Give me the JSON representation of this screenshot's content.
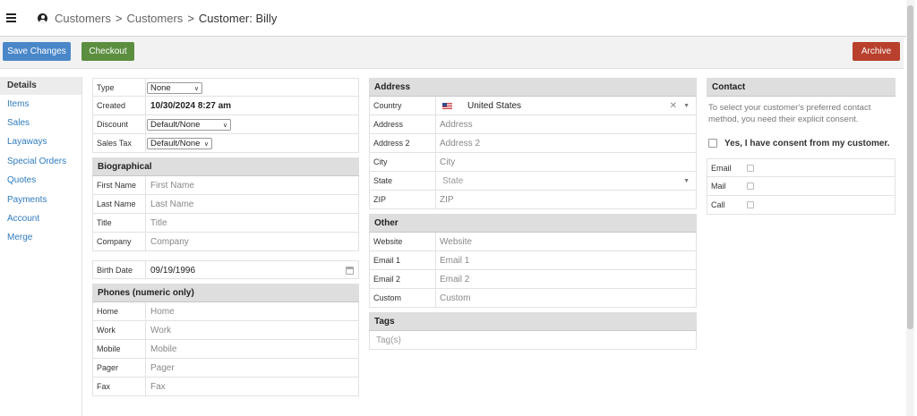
{
  "breadcrumb": {
    "items": [
      "Customers",
      "Customers"
    ],
    "separator": ">",
    "current": "Customer: Billy"
  },
  "toolbar": {
    "save_label": "Save Changes",
    "checkout_label": "Checkout",
    "archive_label": "Archive"
  },
  "colors": {
    "save": "#4a87c9",
    "checkout": "#5b8e3f",
    "archive": "#b8402c",
    "link": "#2e7bbf"
  },
  "sidebar": {
    "items": [
      {
        "label": "Details",
        "active": true
      },
      {
        "label": "Items"
      },
      {
        "label": "Sales"
      },
      {
        "label": "Layaways"
      },
      {
        "label": "Special Orders"
      },
      {
        "label": "Quotes"
      },
      {
        "label": "Payments"
      },
      {
        "label": "Account"
      },
      {
        "label": "Merge"
      }
    ]
  },
  "details": {
    "type_label": "Type",
    "type_value": "None",
    "created_label": "Created",
    "created_value": "10/30/2024 8:27 am",
    "discount_label": "Discount",
    "discount_value": "Default/None",
    "sales_tax_label": "Sales Tax",
    "sales_tax_value": "Default/None"
  },
  "biographical": {
    "title": "Biographical",
    "fields": [
      {
        "label": "First Name",
        "placeholder": "First Name"
      },
      {
        "label": "Last Name",
        "placeholder": "Last Name"
      },
      {
        "label": "Title",
        "placeholder": "Title"
      },
      {
        "label": "Company",
        "placeholder": "Company"
      }
    ],
    "birth_date_label": "Birth Date",
    "birth_date_value": "09/19/1996"
  },
  "phones": {
    "title": "Phones (numeric only)",
    "fields": [
      {
        "label": "Home",
        "placeholder": "Home"
      },
      {
        "label": "Work",
        "placeholder": "Work"
      },
      {
        "label": "Mobile",
        "placeholder": "Mobile"
      },
      {
        "label": "Pager",
        "placeholder": "Pager"
      },
      {
        "label": "Fax",
        "placeholder": "Fax"
      }
    ]
  },
  "address": {
    "title": "Address",
    "country_label": "Country",
    "country_value": "United States",
    "fields": [
      {
        "label": "Address",
        "placeholder": "Address"
      },
      {
        "label": "Address 2",
        "placeholder": "Address 2"
      },
      {
        "label": "City",
        "placeholder": "City"
      }
    ],
    "state_label": "State",
    "state_placeholder": "State",
    "zip_label": "ZIP",
    "zip_placeholder": "ZIP"
  },
  "other": {
    "title": "Other",
    "fields": [
      {
        "label": "Website",
        "placeholder": "Website"
      },
      {
        "label": "Email 1",
        "placeholder": "Email 1"
      },
      {
        "label": "Email 2",
        "placeholder": "Email 2"
      },
      {
        "label": "Custom",
        "placeholder": "Custom"
      }
    ]
  },
  "tags": {
    "title": "Tags",
    "placeholder": "Tag(s)"
  },
  "contact": {
    "title": "Contact",
    "consent_text": "To select your customer's preferred contact method, you need their explicit consent.",
    "consent_label": "Yes, I have consent from my customer.",
    "methods": [
      {
        "label": "Email"
      },
      {
        "label": "Mail"
      },
      {
        "label": "Call"
      }
    ]
  }
}
